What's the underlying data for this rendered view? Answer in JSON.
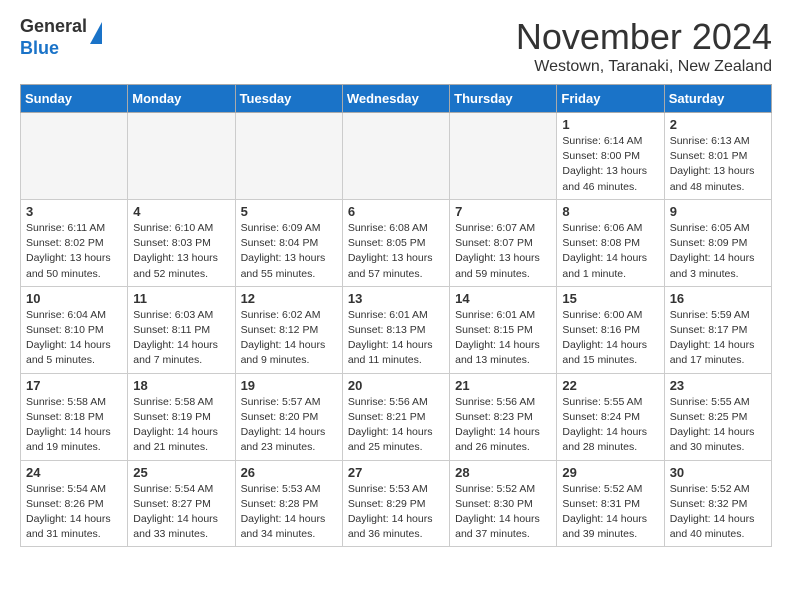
{
  "header": {
    "logo_line1": "General",
    "logo_line2": "Blue",
    "month_title": "November 2024",
    "location": "Westown, Taranaki, New Zealand"
  },
  "days_of_week": [
    "Sunday",
    "Monday",
    "Tuesday",
    "Wednesday",
    "Thursday",
    "Friday",
    "Saturday"
  ],
  "weeks": [
    [
      {
        "day": "",
        "info": ""
      },
      {
        "day": "",
        "info": ""
      },
      {
        "day": "",
        "info": ""
      },
      {
        "day": "",
        "info": ""
      },
      {
        "day": "",
        "info": ""
      },
      {
        "day": "1",
        "info": "Sunrise: 6:14 AM\nSunset: 8:00 PM\nDaylight: 13 hours\nand 46 minutes."
      },
      {
        "day": "2",
        "info": "Sunrise: 6:13 AM\nSunset: 8:01 PM\nDaylight: 13 hours\nand 48 minutes."
      }
    ],
    [
      {
        "day": "3",
        "info": "Sunrise: 6:11 AM\nSunset: 8:02 PM\nDaylight: 13 hours\nand 50 minutes."
      },
      {
        "day": "4",
        "info": "Sunrise: 6:10 AM\nSunset: 8:03 PM\nDaylight: 13 hours\nand 52 minutes."
      },
      {
        "day": "5",
        "info": "Sunrise: 6:09 AM\nSunset: 8:04 PM\nDaylight: 13 hours\nand 55 minutes."
      },
      {
        "day": "6",
        "info": "Sunrise: 6:08 AM\nSunset: 8:05 PM\nDaylight: 13 hours\nand 57 minutes."
      },
      {
        "day": "7",
        "info": "Sunrise: 6:07 AM\nSunset: 8:07 PM\nDaylight: 13 hours\nand 59 minutes."
      },
      {
        "day": "8",
        "info": "Sunrise: 6:06 AM\nSunset: 8:08 PM\nDaylight: 14 hours\nand 1 minute."
      },
      {
        "day": "9",
        "info": "Sunrise: 6:05 AM\nSunset: 8:09 PM\nDaylight: 14 hours\nand 3 minutes."
      }
    ],
    [
      {
        "day": "10",
        "info": "Sunrise: 6:04 AM\nSunset: 8:10 PM\nDaylight: 14 hours\nand 5 minutes."
      },
      {
        "day": "11",
        "info": "Sunrise: 6:03 AM\nSunset: 8:11 PM\nDaylight: 14 hours\nand 7 minutes."
      },
      {
        "day": "12",
        "info": "Sunrise: 6:02 AM\nSunset: 8:12 PM\nDaylight: 14 hours\nand 9 minutes."
      },
      {
        "day": "13",
        "info": "Sunrise: 6:01 AM\nSunset: 8:13 PM\nDaylight: 14 hours\nand 11 minutes."
      },
      {
        "day": "14",
        "info": "Sunrise: 6:01 AM\nSunset: 8:15 PM\nDaylight: 14 hours\nand 13 minutes."
      },
      {
        "day": "15",
        "info": "Sunrise: 6:00 AM\nSunset: 8:16 PM\nDaylight: 14 hours\nand 15 minutes."
      },
      {
        "day": "16",
        "info": "Sunrise: 5:59 AM\nSunset: 8:17 PM\nDaylight: 14 hours\nand 17 minutes."
      }
    ],
    [
      {
        "day": "17",
        "info": "Sunrise: 5:58 AM\nSunset: 8:18 PM\nDaylight: 14 hours\nand 19 minutes."
      },
      {
        "day": "18",
        "info": "Sunrise: 5:58 AM\nSunset: 8:19 PM\nDaylight: 14 hours\nand 21 minutes."
      },
      {
        "day": "19",
        "info": "Sunrise: 5:57 AM\nSunset: 8:20 PM\nDaylight: 14 hours\nand 23 minutes."
      },
      {
        "day": "20",
        "info": "Sunrise: 5:56 AM\nSunset: 8:21 PM\nDaylight: 14 hours\nand 25 minutes."
      },
      {
        "day": "21",
        "info": "Sunrise: 5:56 AM\nSunset: 8:23 PM\nDaylight: 14 hours\nand 26 minutes."
      },
      {
        "day": "22",
        "info": "Sunrise: 5:55 AM\nSunset: 8:24 PM\nDaylight: 14 hours\nand 28 minutes."
      },
      {
        "day": "23",
        "info": "Sunrise: 5:55 AM\nSunset: 8:25 PM\nDaylight: 14 hours\nand 30 minutes."
      }
    ],
    [
      {
        "day": "24",
        "info": "Sunrise: 5:54 AM\nSunset: 8:26 PM\nDaylight: 14 hours\nand 31 minutes."
      },
      {
        "day": "25",
        "info": "Sunrise: 5:54 AM\nSunset: 8:27 PM\nDaylight: 14 hours\nand 33 minutes."
      },
      {
        "day": "26",
        "info": "Sunrise: 5:53 AM\nSunset: 8:28 PM\nDaylight: 14 hours\nand 34 minutes."
      },
      {
        "day": "27",
        "info": "Sunrise: 5:53 AM\nSunset: 8:29 PM\nDaylight: 14 hours\nand 36 minutes."
      },
      {
        "day": "28",
        "info": "Sunrise: 5:52 AM\nSunset: 8:30 PM\nDaylight: 14 hours\nand 37 minutes."
      },
      {
        "day": "29",
        "info": "Sunrise: 5:52 AM\nSunset: 8:31 PM\nDaylight: 14 hours\nand 39 minutes."
      },
      {
        "day": "30",
        "info": "Sunrise: 5:52 AM\nSunset: 8:32 PM\nDaylight: 14 hours\nand 40 minutes."
      }
    ]
  ]
}
